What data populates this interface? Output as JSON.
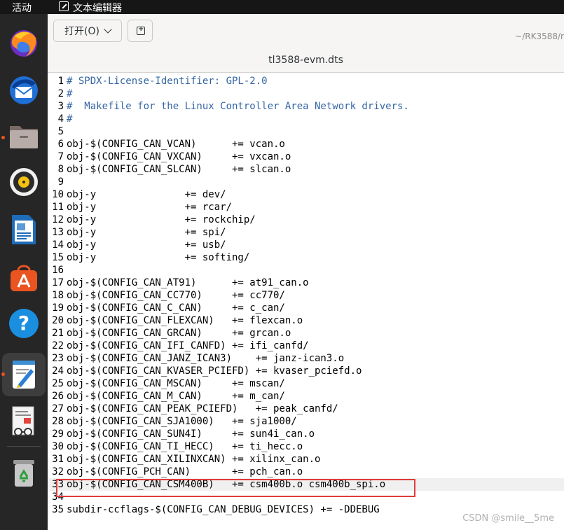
{
  "topbar": {
    "activities": "活动",
    "app_name": "文本编辑器",
    "app_icon": "text-editor-icon"
  },
  "dock": {
    "items": [
      {
        "name": "firefox-icon"
      },
      {
        "name": "thunderbird-icon"
      },
      {
        "name": "files-icon"
      },
      {
        "name": "rhythmbox-icon"
      },
      {
        "name": "libreoffice-writer-icon"
      },
      {
        "name": "app-center-icon"
      },
      {
        "name": "help-icon"
      },
      {
        "name": "text-editor-icon"
      },
      {
        "name": "document-viewer-icon"
      },
      {
        "name": "trash-icon"
      }
    ]
  },
  "header": {
    "open_label": "打开(O)",
    "newtab_icon": "new-tab-icon",
    "path": "~/RK3588/r",
    "title": "tl3588-evm.dts"
  },
  "editor": {
    "current_line": 33,
    "lines": [
      {
        "num": "1",
        "text": "# SPDX-License-Identifier: GPL-2.0",
        "comment": true
      },
      {
        "num": "2",
        "text": "#",
        "comment": true
      },
      {
        "num": "3",
        "text": "#  Makefile for the Linux Controller Area Network drivers.",
        "comment": true
      },
      {
        "num": "4",
        "text": "#",
        "comment": true
      },
      {
        "num": "5",
        "text": ""
      },
      {
        "num": "6",
        "text": "obj-$(CONFIG_CAN_VCAN)      += vcan.o"
      },
      {
        "num": "7",
        "text": "obj-$(CONFIG_CAN_VXCAN)     += vxcan.o"
      },
      {
        "num": "8",
        "text": "obj-$(CONFIG_CAN_SLCAN)     += slcan.o"
      },
      {
        "num": "9",
        "text": ""
      },
      {
        "num": "10",
        "text": "obj-y               += dev/"
      },
      {
        "num": "11",
        "text": "obj-y               += rcar/"
      },
      {
        "num": "12",
        "text": "obj-y               += rockchip/"
      },
      {
        "num": "13",
        "text": "obj-y               += spi/"
      },
      {
        "num": "14",
        "text": "obj-y               += usb/"
      },
      {
        "num": "15",
        "text": "obj-y               += softing/"
      },
      {
        "num": "16",
        "text": ""
      },
      {
        "num": "17",
        "text": "obj-$(CONFIG_CAN_AT91)      += at91_can.o"
      },
      {
        "num": "18",
        "text": "obj-$(CONFIG_CAN_CC770)     += cc770/"
      },
      {
        "num": "19",
        "text": "obj-$(CONFIG_CAN_C_CAN)     += c_can/"
      },
      {
        "num": "20",
        "text": "obj-$(CONFIG_CAN_FLEXCAN)   += flexcan.o"
      },
      {
        "num": "21",
        "text": "obj-$(CONFIG_CAN_GRCAN)     += grcan.o"
      },
      {
        "num": "22",
        "text": "obj-$(CONFIG_CAN_IFI_CANFD) += ifi_canfd/"
      },
      {
        "num": "23",
        "text": "obj-$(CONFIG_CAN_JANZ_ICAN3)    += janz-ican3.o"
      },
      {
        "num": "24",
        "text": "obj-$(CONFIG_CAN_KVASER_PCIEFD) += kvaser_pciefd.o"
      },
      {
        "num": "25",
        "text": "obj-$(CONFIG_CAN_MSCAN)     += mscan/"
      },
      {
        "num": "26",
        "text": "obj-$(CONFIG_CAN_M_CAN)     += m_can/"
      },
      {
        "num": "27",
        "text": "obj-$(CONFIG_CAN_PEAK_PCIEFD)   += peak_canfd/"
      },
      {
        "num": "28",
        "text": "obj-$(CONFIG_CAN_SJA1000)   += sja1000/"
      },
      {
        "num": "29",
        "text": "obj-$(CONFIG_CAN_SUN4I)     += sun4i_can.o"
      },
      {
        "num": "30",
        "text": "obj-$(CONFIG_CAN_TI_HECC)   += ti_hecc.o"
      },
      {
        "num": "31",
        "text": "obj-$(CONFIG_CAN_XILINXCAN) += xilinx_can.o"
      },
      {
        "num": "32",
        "text": "obj-$(CONFIG_PCH_CAN)       += pch_can.o"
      },
      {
        "num": "33",
        "text": "obj-$(CONFIG_CAN_CSM400B)   += csm400b.o csm400b_spi.o"
      },
      {
        "num": "34",
        "text": ""
      },
      {
        "num": "35",
        "text": "subdir-ccflags-$(CONFIG_CAN_DEBUG_DEVICES) += -DDEBUG"
      }
    ]
  },
  "watermark": "CSDN @smile__5me",
  "colors": {
    "highlight_border": "#e03b3b",
    "comment": "#3465a4",
    "dock_bg": "#262626",
    "topbar_bg": "#161616"
  }
}
